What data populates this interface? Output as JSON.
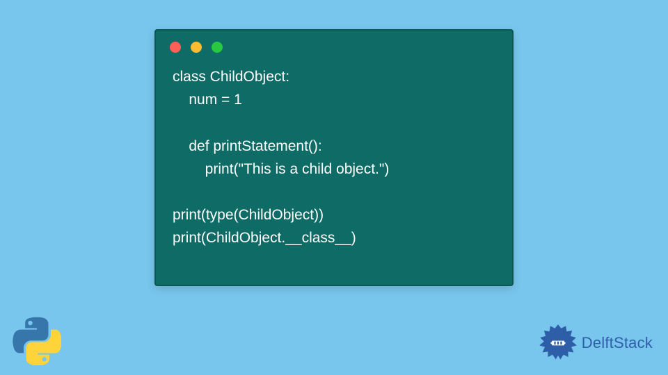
{
  "window": {
    "dots": {
      "red": "#ff5f57",
      "yellow": "#febc2e",
      "green": "#28c840"
    }
  },
  "code": {
    "lines": [
      "class ChildObject:",
      "    num = 1",
      "",
      "    def printStatement():",
      "        print(\"This is a child object.\")",
      "",
      "print(type(ChildObject))",
      "print(ChildObject.__class__)"
    ]
  },
  "branding": {
    "delft_label": "DelftStack",
    "python_icon_name": "python-logo-icon",
    "delft_icon_name": "delftstack-logo-icon"
  },
  "colors": {
    "page_bg": "#78c6ed",
    "window_bg": "#0e6b65",
    "code_text": "#ffffff",
    "brand_text": "#2e5ea8"
  }
}
